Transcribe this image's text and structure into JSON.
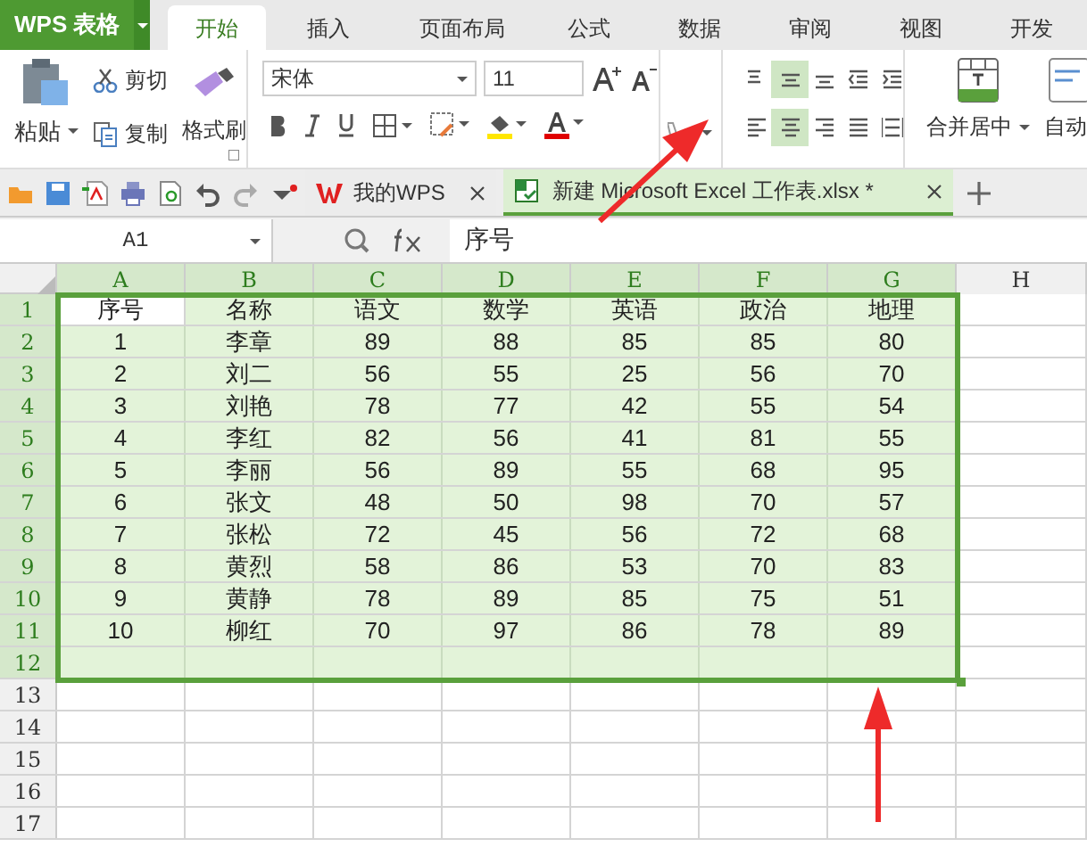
{
  "app": {
    "logo": "WPS 表格"
  },
  "tabs": [
    {
      "label": "开始",
      "selected": true
    },
    {
      "label": "插入",
      "selected": false
    },
    {
      "label": "页面布局",
      "selected": false
    },
    {
      "label": "公式",
      "selected": false
    },
    {
      "label": "数据",
      "selected": false
    },
    {
      "label": "审阅",
      "selected": false
    },
    {
      "label": "视图",
      "selected": false
    },
    {
      "label": "开发",
      "selected": false
    }
  ],
  "clipboard": {
    "paste": "粘贴",
    "cut": "剪切",
    "copy": "复制",
    "format_painter": "格式刷"
  },
  "font": {
    "name": "宋体",
    "size": "11"
  },
  "alignment": [
    {
      "kind": "top",
      "selected": false
    },
    {
      "kind": "middle",
      "selected": true
    },
    {
      "kind": "bottom",
      "selected": false
    },
    {
      "kind": "outdent",
      "selected": false
    },
    {
      "kind": "indent",
      "selected": false
    },
    {
      "kind": "left",
      "selected": false
    },
    {
      "kind": "center",
      "selected": true
    },
    {
      "kind": "right",
      "selected": false
    },
    {
      "kind": "justify",
      "selected": false
    },
    {
      "kind": "distribute",
      "selected": false
    }
  ],
  "merge": "合并居中",
  "wrap": "自动",
  "doc_tabs": [
    {
      "label": "我的WPS",
      "selected": false
    },
    {
      "label": "新建 Microsoft Excel 工作表.xlsx *",
      "selected": true
    }
  ],
  "name_box": "A1",
  "formula": "序号",
  "columns": [
    {
      "label": "A",
      "selected": true
    },
    {
      "label": "B",
      "selected": true
    },
    {
      "label": "C",
      "selected": true
    },
    {
      "label": "D",
      "selected": true
    },
    {
      "label": "E",
      "selected": true
    },
    {
      "label": "F",
      "selected": true
    },
    {
      "label": "G",
      "selected": true
    },
    {
      "label": "H",
      "selected": false
    }
  ],
  "rows": [
    {
      "label": "1",
      "selected": true,
      "cells": [
        "序号",
        "名称",
        "语文",
        "数学",
        "英语",
        "政治",
        "地理"
      ]
    },
    {
      "label": "2",
      "selected": true,
      "cells": [
        "1",
        "李章",
        "89",
        "88",
        "85",
        "85",
        "80"
      ]
    },
    {
      "label": "3",
      "selected": true,
      "cells": [
        "2",
        "刘二",
        "56",
        "55",
        "25",
        "56",
        "70"
      ]
    },
    {
      "label": "4",
      "selected": true,
      "cells": [
        "3",
        "刘艳",
        "78",
        "77",
        "42",
        "55",
        "54"
      ]
    },
    {
      "label": "5",
      "selected": true,
      "cells": [
        "4",
        "李红",
        "82",
        "56",
        "41",
        "81",
        "55"
      ]
    },
    {
      "label": "6",
      "selected": true,
      "cells": [
        "5",
        "李丽",
        "56",
        "89",
        "55",
        "68",
        "95"
      ]
    },
    {
      "label": "7",
      "selected": true,
      "cells": [
        "6",
        "张文",
        "48",
        "50",
        "98",
        "70",
        "57"
      ]
    },
    {
      "label": "8",
      "selected": true,
      "cells": [
        "7",
        "张松",
        "72",
        "45",
        "56",
        "72",
        "68"
      ]
    },
    {
      "label": "9",
      "selected": true,
      "cells": [
        "8",
        "黄烈",
        "58",
        "86",
        "53",
        "70",
        "83"
      ]
    },
    {
      "label": "10",
      "selected": true,
      "cells": [
        "9",
        "黄静",
        "78",
        "89",
        "85",
        "75",
        "51"
      ]
    },
    {
      "label": "11",
      "selected": true,
      "cells": [
        "10",
        "柳红",
        "70",
        "97",
        "86",
        "78",
        "89"
      ]
    },
    {
      "label": "12",
      "selected": true,
      "cells": []
    },
    {
      "label": "13",
      "selected": false,
      "cells": []
    },
    {
      "label": "14",
      "selected": false,
      "cells": []
    },
    {
      "label": "15",
      "selected": false,
      "cells": []
    },
    {
      "label": "16",
      "selected": false,
      "cells": []
    },
    {
      "label": "17",
      "selected": false,
      "cells": []
    }
  ]
}
